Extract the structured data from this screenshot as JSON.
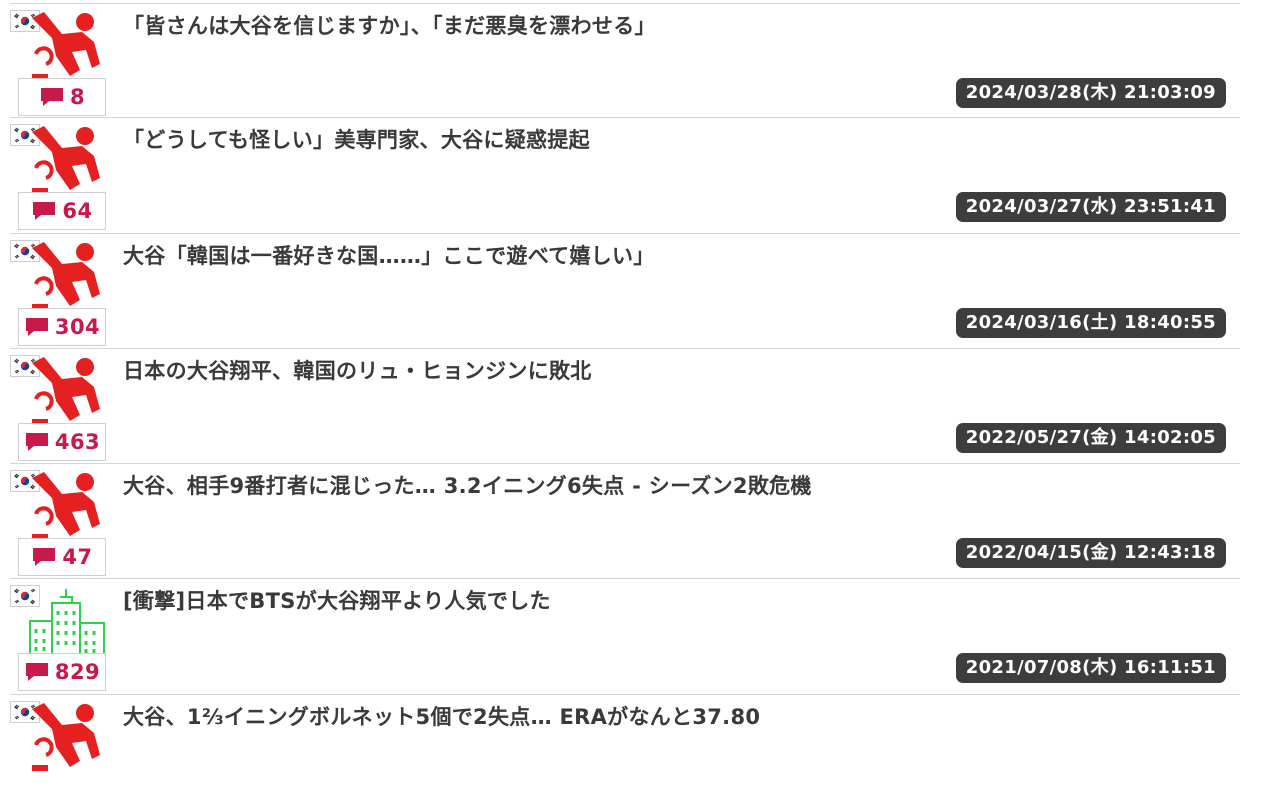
{
  "articles": [
    {
      "title": "「皆さんは大谷を信じますか」、「まだ悪臭を漂わせる」",
      "date": "2024/03/28(木) 21:03:09",
      "comments": "8",
      "thumb": "baseball-player-icon"
    },
    {
      "title": "「どうしても怪しい」美専門家、大谷に疑惑提起",
      "date": "2024/03/27(水) 23:51:41",
      "comments": "64",
      "thumb": "baseball-player-icon"
    },
    {
      "title": "大谷「韓国は一番好きな国……」ここで遊べて嬉しい」",
      "date": "2024/03/16(土) 18:40:55",
      "comments": "304",
      "thumb": "baseball-player-icon"
    },
    {
      "title": "日本の大谷翔平、韓国のリュ・ヒョンジンに敗北",
      "date": "2022/05/27(金) 14:02:05",
      "comments": "463",
      "thumb": "baseball-player-icon"
    },
    {
      "title": "大谷、相手9番打者に混じった… 3.2イニング6失点 - シーズン2敗危機",
      "date": "2022/04/15(金) 12:43:18",
      "comments": "47",
      "thumb": "baseball-player-icon"
    },
    {
      "title": "[衝撃]日本でBTSが大谷翔平より人気でした",
      "date": "2021/07/08(木) 16:11:51",
      "comments": "829",
      "thumb": "building-icon"
    },
    {
      "title": "大谷、1⅔イニングボルネット5個で2失点… ERAがなんと37.80",
      "date": "",
      "comments": "",
      "thumb": "baseball-player-icon"
    }
  ],
  "colors": {
    "accent": "#c8194b",
    "player_icon": "#e52020",
    "building_icon": "#2ed24a",
    "date_badge_bg": "#3d3d3d",
    "title_text": "#3a3a3a"
  },
  "icons": {
    "flag": "korea-flag-icon",
    "comment": "speech-bubble-icon"
  }
}
